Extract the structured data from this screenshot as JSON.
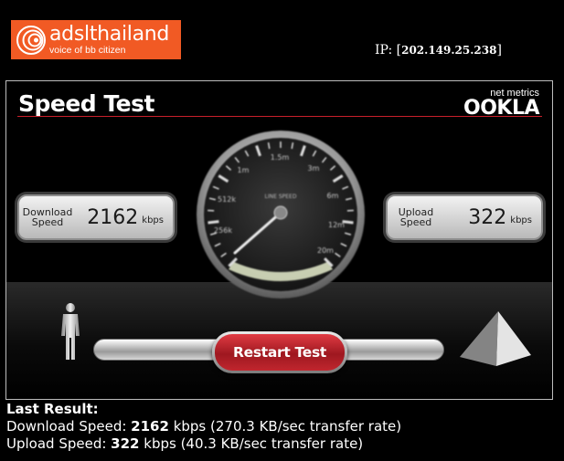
{
  "logo": {
    "name": "adslthailand",
    "tagline": "voice of bb citizen",
    "icon": "concentric-circles-icon",
    "color": "#f15a24"
  },
  "ip": {
    "label": "IP:",
    "value": "202.149.25.238"
  },
  "widget": {
    "title": "Speed Test",
    "brand_sub": "net metrics",
    "brand_name": "OOKLA",
    "accent_color": "#c8202b"
  },
  "gauge": {
    "label": "LINE SPEED",
    "ticks": [
      "1m",
      "1.5m",
      "3m",
      "6m",
      "12m",
      "20m",
      "512k",
      "256k"
    ],
    "needle_value": "2162 kbps"
  },
  "download": {
    "label_line1": "Download",
    "label_line2": "Speed",
    "value": "2162",
    "unit": "kbps"
  },
  "upload": {
    "label_line1": "Upload",
    "label_line2": "Speed",
    "value": "322",
    "unit": "kbps"
  },
  "restart_button": {
    "label": "Restart Test",
    "color": "#b8212a"
  },
  "icons": {
    "left": "person-icon",
    "right": "pyramid-server-icon"
  },
  "results": {
    "heading": "Last Result:",
    "download_prefix": "Download Speed: ",
    "download_value": "2162",
    "download_suffix": " kbps (270.3 KB/sec transfer rate)",
    "upload_prefix": "Upload Speed: ",
    "upload_value": "322",
    "upload_suffix": " kbps (40.3 KB/sec transfer rate)"
  }
}
